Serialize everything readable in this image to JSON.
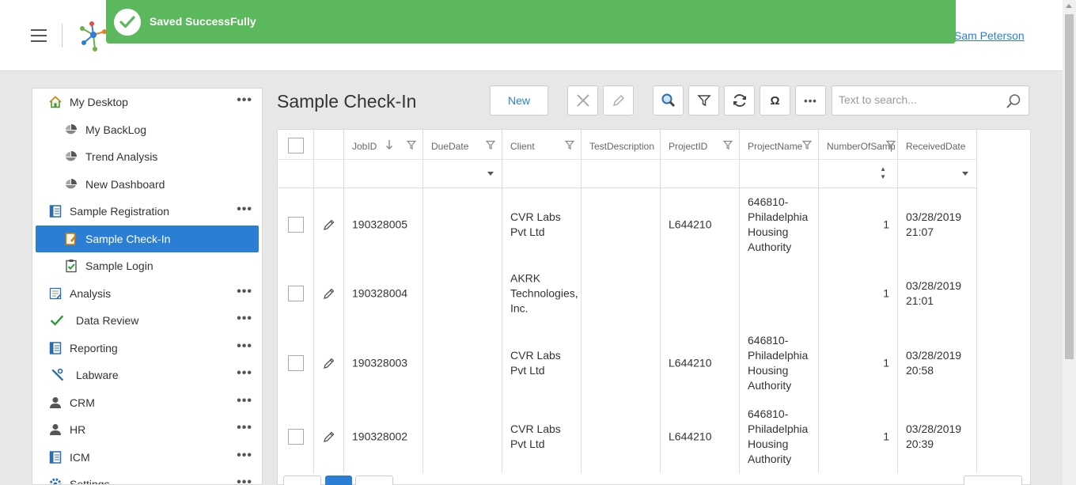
{
  "toast": {
    "message": "Saved SuccessFully"
  },
  "header": {
    "user": "Sam Peterson"
  },
  "sidebar": {
    "items": [
      {
        "label": "My Desktop",
        "icon": "home-icon",
        "more": true
      },
      {
        "label": "My BackLog",
        "icon": "chart-icon",
        "sub": true
      },
      {
        "label": "Trend Analysis",
        "icon": "chart-icon",
        "sub": true
      },
      {
        "label": "New Dashboard",
        "icon": "chart-icon",
        "sub": true
      },
      {
        "label": "Sample Registration",
        "icon": "form-icon",
        "more": true
      },
      {
        "label": "Sample Check-In",
        "icon": "checkin-icon",
        "sub": true,
        "active": true
      },
      {
        "label": "Sample Login",
        "icon": "checklist-icon",
        "sub": true
      },
      {
        "label": "Analysis",
        "icon": "analysis-icon",
        "more": true
      },
      {
        "label": "Data Review",
        "icon": "check-icon",
        "more": true
      },
      {
        "label": "Reporting",
        "icon": "form-icon",
        "more": true
      },
      {
        "label": "Labware",
        "icon": "tools-icon",
        "more": true
      },
      {
        "label": "CRM",
        "icon": "person-icon",
        "more": true
      },
      {
        "label": "HR",
        "icon": "person-icon",
        "more": true
      },
      {
        "label": "ICM",
        "icon": "form-icon",
        "more": true
      },
      {
        "label": "Settings",
        "icon": "gear-icon",
        "more": true
      }
    ],
    "more_glyph": "•••"
  },
  "main": {
    "title": "Sample Check-In",
    "new_label": "New",
    "more_glyph": "•••",
    "omega_glyph": "Ω",
    "search_placeholder": "Text to search..."
  },
  "grid": {
    "columns": [
      "JobID",
      "DueDate",
      "Client",
      "TestDescription",
      "ProjectID",
      "ProjectName",
      "NumberOfSampl",
      "ReceivedDate"
    ],
    "rows": [
      {
        "jobid": "190328005",
        "duedate": "",
        "client": "CVR Labs Pvt Ltd",
        "testdesc": "",
        "projectid": "L644210",
        "projectname": "646810-Philadelphia Housing Authority",
        "samples": "1",
        "received": "03/28/2019 21:07"
      },
      {
        "jobid": "190328004",
        "duedate": "",
        "client": "AKRK Technologies, Inc.",
        "testdesc": "",
        "projectid": "",
        "projectname": "",
        "samples": "1",
        "received": "03/28/2019 21:01"
      },
      {
        "jobid": "190328003",
        "duedate": "",
        "client": "CVR Labs Pvt Ltd",
        "testdesc": "",
        "projectid": "L644210",
        "projectname": "646810-Philadelphia Housing Authority",
        "samples": "1",
        "received": "03/28/2019 20:58"
      },
      {
        "jobid": "190328002",
        "duedate": "",
        "client": "CVR Labs Pvt Ltd",
        "testdesc": "",
        "projectid": "L644210",
        "projectname": "646810-Philadelphia Housing Authority",
        "samples": "1",
        "received": "03/28/2019 20:39"
      }
    ]
  },
  "colors": {
    "accent": "#2a7fd4",
    "toast": "#5cb85c",
    "check": "#2a9d3a"
  }
}
